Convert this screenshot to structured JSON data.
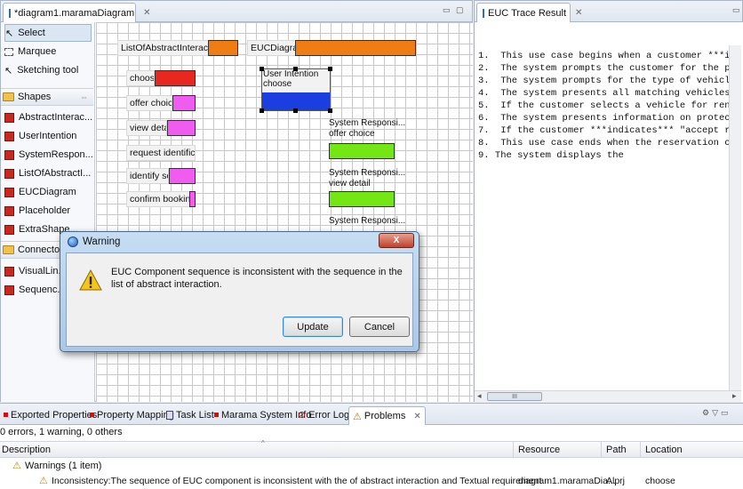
{
  "editor": {
    "tab_title": "*diagram1.maramaDiagram",
    "palette": {
      "tools": [
        "Select",
        "Marquee",
        "Sketching tool"
      ],
      "shapes_header": "Shapes",
      "shapes": [
        "AbstractInterac...",
        "UserIntention",
        "SystemRespon...",
        "ListOfAbstractI...",
        "EUCDiagram",
        "Placeholder",
        "ExtraShape..."
      ],
      "connectors_header": "Connectors",
      "connectors": [
        "VisualLin...",
        "Sequenc..."
      ]
    },
    "canvas": {
      "list_header": "ListOfAbstractInteraction",
      "euc_header": "EUCDiagram",
      "interactions": [
        "choose",
        "offer choice",
        "view detail",
        "request identific...",
        "identify self",
        "confirm booking"
      ],
      "user_intention_title": "User Intention",
      "user_intention_label": "choose",
      "system_responses": [
        {
          "title": "System Responsi...",
          "label": "offer choice"
        },
        {
          "title": "System Responsi...",
          "label": "view detail"
        },
        {
          "title": "System Responsi...",
          "label": ""
        }
      ]
    },
    "colors": {
      "orange": "#f07d14",
      "red": "#e8281e",
      "magenta": "#f05cf0",
      "blue": "#1a3ee0",
      "green": "#74e614"
    }
  },
  "trace": {
    "tab_title": "EUC Trace Result",
    "lines": [
      "1.  This use case begins when a customer ***ind",
      "2.  The system prompts the customer for the pic",
      "3.  The system prompts for the type of vehicle",
      "4.  The system presents all matching vehicles a",
      "5.  If the customer selects a vehicle for renta",
      "6.  The system presents information on protecti",
      "7.  If the customer ***indicates*** \"accept res",
      "8.  This use case ends when the reservation con",
      "9. The system displays the"
    ],
    "scroll_thumb": "III"
  },
  "bottom": {
    "tabs": [
      "Exported Properties",
      "Property Mapping",
      "Task List",
      "Marama System Info",
      "Error Log",
      "Problems"
    ],
    "summary": "0 errors, 1 warning, 0 others",
    "columns": [
      "Description",
      "Resource",
      "Path",
      "Location"
    ],
    "group_label": "Warnings (1 item)",
    "rows": [
      {
        "description": "Inconsistency:The sequence of EUC component is inconsistent with the of abstract interaction and Textual requirement",
        "resource": "diagram1.maramaDia...",
        "path": "Alprj",
        "location": "choose"
      }
    ]
  },
  "dialog": {
    "title": "Warning",
    "message": "EUC Component sequence is inconsistent with the sequence in the list of abstract interaction.",
    "update_label": "Update",
    "cancel_label": "Cancel",
    "close_glyph": "X"
  }
}
